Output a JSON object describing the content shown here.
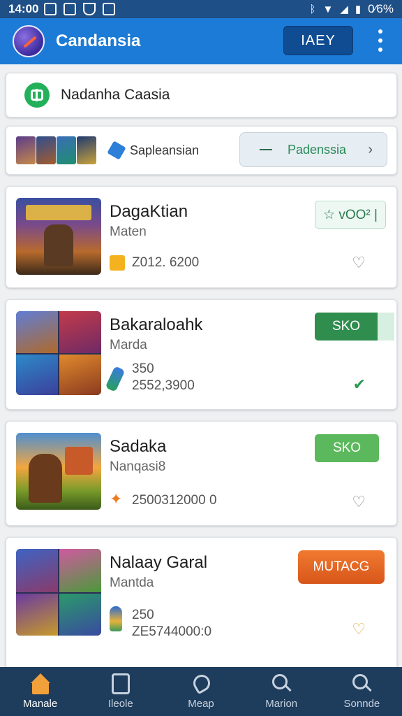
{
  "status_bar": {
    "time": "14:00",
    "battery": "0⁄6%",
    "icons": [
      "notification-icon",
      "settings-icon",
      "shield-icon",
      "gallery-icon",
      "bluetooth-icon",
      "wifi-icon",
      "battery-icon"
    ]
  },
  "app_bar": {
    "title": "Candansia",
    "action_label": "IAEY",
    "logo_icon": "compass-logo-icon",
    "menu_icon": "more-vert-icon",
    "color": "#1c7bd6"
  },
  "search": {
    "text": "Nadanha Caasia",
    "icon": "plus-box-icon"
  },
  "filter": {
    "label": "Sapleansian",
    "button_label": "Padenssia",
    "icon": "cube-icon"
  },
  "games": [
    {
      "title": "DagaKtian",
      "subtitle": "Maten",
      "stat_line1": "",
      "stat_line2": "Z012. 6200",
      "action_label": "☆ ᴠOO² |",
      "action_style": "outline",
      "heart_icon": "heart-outline-icon",
      "stat_icon": "coin-icon"
    },
    {
      "title": "Bakaraloahk",
      "subtitle": "Marda",
      "stat_line1": "350",
      "stat_line2": "2552,3900",
      "action_label": "SKO",
      "action_style": "dark-green",
      "heart_icon": "check-icon",
      "stat_icon": "potion-icon"
    },
    {
      "title": "Sadaka",
      "subtitle": "Nanqasi8",
      "stat_line1": "",
      "stat_line2": "2500312000 0",
      "action_label": "SKO",
      "action_style": "green",
      "heart_icon": "heart-outline-icon",
      "stat_icon": "flame-icon"
    },
    {
      "title": "Nalaay Garal",
      "subtitle": "Mantda",
      "stat_line1": "250",
      "stat_line2": "ZE5744000:0",
      "action_label": "MUTACG",
      "action_style": "orange",
      "heart_icon": "heart-outline-icon",
      "stat_icon": "lightbulb-icon"
    }
  ],
  "bottom_nav": [
    {
      "label": "Manale",
      "icon": "home-icon"
    },
    {
      "label": "Ileole",
      "icon": "tablet-icon"
    },
    {
      "label": "Meap",
      "icon": "map-icon"
    },
    {
      "label": "Marion",
      "icon": "search-icon"
    },
    {
      "label": "Sonnde",
      "icon": "search-icon"
    }
  ]
}
